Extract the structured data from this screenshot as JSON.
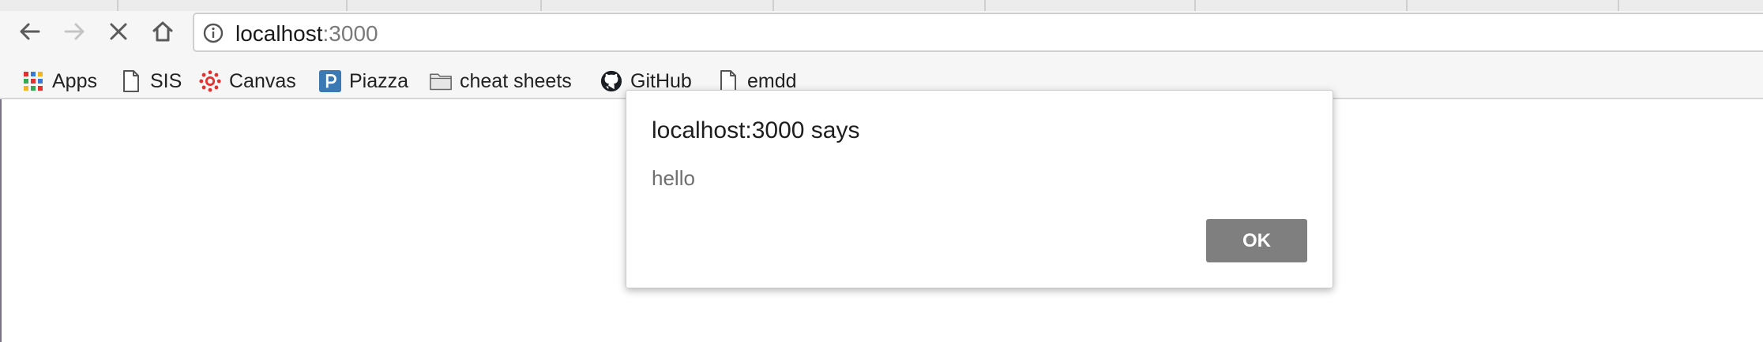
{
  "browser": {
    "address_bar": {
      "host": "localhost",
      "port": ":3000"
    },
    "bookmarks": [
      {
        "label": "Apps",
        "icon": "apps-grid-icon"
      },
      {
        "label": "SIS",
        "icon": "page-icon"
      },
      {
        "label": "Canvas",
        "icon": "canvas-icon"
      },
      {
        "label": "Piazza",
        "icon": "piazza-icon"
      },
      {
        "label": "cheat sheets",
        "icon": "folder-icon"
      },
      {
        "label": "GitHub",
        "icon": "github-icon"
      },
      {
        "label": "emdd",
        "icon": "page-icon"
      }
    ]
  },
  "dialog": {
    "title": "localhost:3000 says",
    "message": "hello",
    "ok_label": "OK"
  },
  "colors": {
    "ok_button": "#7f7f7f",
    "canvas_red": "#e4312f",
    "piazza_blue": "#3b79b4"
  }
}
